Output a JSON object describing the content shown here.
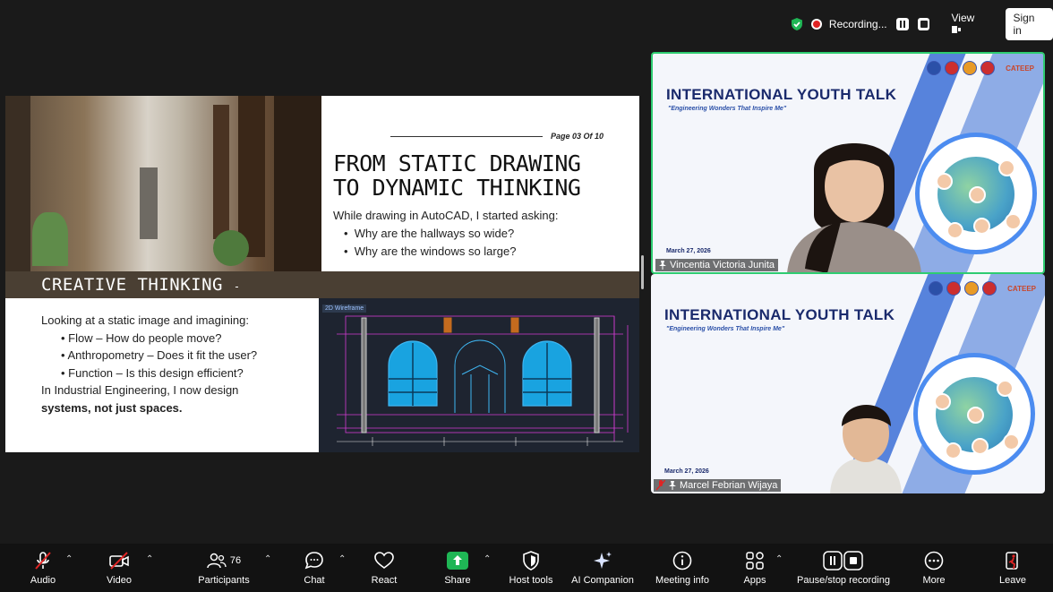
{
  "top_bar": {
    "recording_label": "Recording...",
    "view_label": "View",
    "sign_in_label": "Sign in"
  },
  "slide": {
    "page_number": "Page 03 Of 10",
    "title_line1": "FROM STATIC DRAWING",
    "title_line2": "TO DYNAMIC THINKING",
    "question_intro": "While drawing in AutoCAD, I started asking:",
    "questions": [
      "Why are the hallways so wide?",
      "Why are the windows so large?"
    ],
    "section_title": "CREATIVE THINKING",
    "section_suffix": "-",
    "intro_text": "Looking at a static image and imagining:",
    "bullets": [
      "Flow – How do people move?",
      "Anthropometry – Does it fit the user?",
      "Function – Is this design efficient?"
    ],
    "closing_line": "In Industrial Engineering, I now design",
    "closing_bold": "systems, not just spaces.",
    "cad_label": "2D Wireframe"
  },
  "tiles": [
    {
      "title": "INTERNATIONAL YOUTH TALK",
      "subtitle": "\"Engineering Wonders That Inspire Me\"",
      "date": "March 27, 2026",
      "name": "Vincentia Victoria Junita",
      "logo_text": "CATEEP"
    },
    {
      "title": "INTERNATIONAL YOUTH TALK",
      "subtitle": "\"Engineering Wonders That Inspire Me\"",
      "date": "March 27, 2026",
      "name": "Marcel Febrian Wijaya",
      "logo_text": "CATEEP"
    }
  ],
  "toolbar": {
    "audio": "Audio",
    "video": "Video",
    "participants": "Participants",
    "participants_count": "76",
    "chat": "Chat",
    "react": "React",
    "share": "Share",
    "host_tools": "Host tools",
    "ai_companion": "AI Companion",
    "meeting_info": "Meeting info",
    "apps": "Apps",
    "pause_recording": "Pause/stop recording",
    "more": "More",
    "leave": "Leave"
  },
  "colors": {
    "share_green": "#1fb655",
    "leave_red": "#e02424",
    "active_speaker": "#2ecc71",
    "tile_title": "#1a2a6c"
  },
  "icons": [
    "shield-check-icon",
    "record-dot-icon",
    "pause-icon",
    "stop-icon",
    "view-icon",
    "mic-muted-icon",
    "video-off-icon",
    "participants-icon",
    "chat-icon",
    "heart-icon",
    "share-arrow-icon",
    "host-shield-icon",
    "sparkle-icon",
    "info-icon",
    "apps-icon",
    "pause-stop-icon",
    "more-icon",
    "leave-icon"
  ]
}
